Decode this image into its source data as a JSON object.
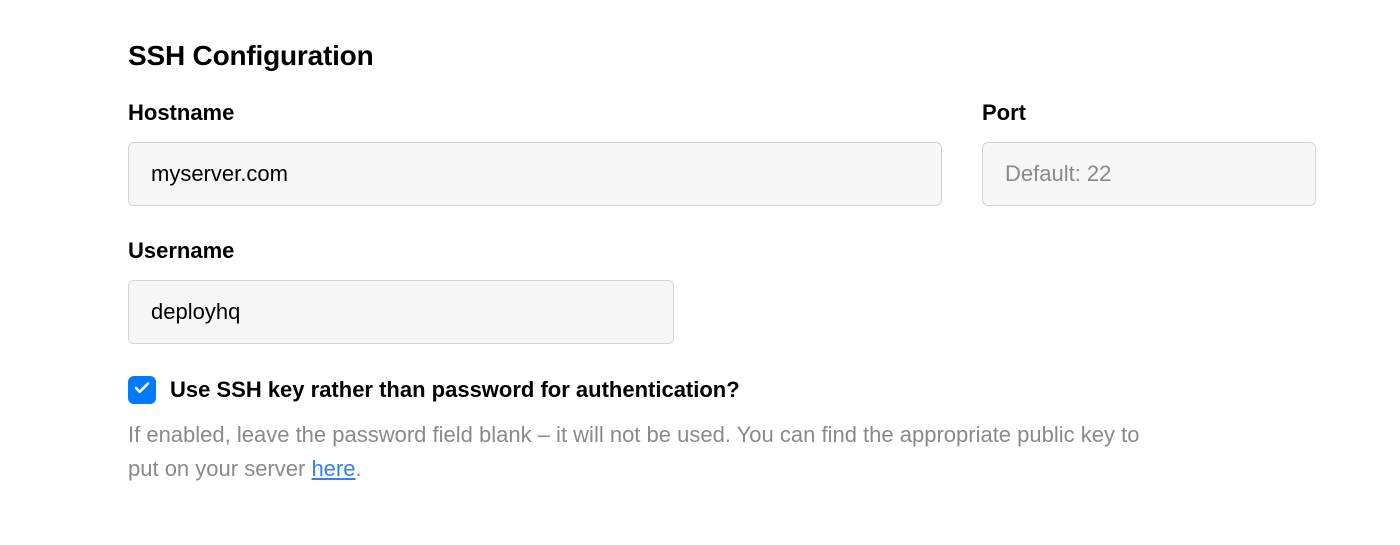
{
  "section": {
    "title": "SSH Configuration"
  },
  "fields": {
    "hostname": {
      "label": "Hostname",
      "value": "myserver.com",
      "placeholder": ""
    },
    "port": {
      "label": "Port",
      "value": "",
      "placeholder": "Default: 22"
    },
    "username": {
      "label": "Username",
      "value": "deployhq",
      "placeholder": ""
    }
  },
  "ssh_key_option": {
    "checked": true,
    "label": "Use SSH key rather than password for authentication?",
    "help_prefix": "If enabled, leave the password field blank – it will not be used. You can find the appropriate public key to put on your server ",
    "help_link_text": "here",
    "help_suffix": "."
  },
  "colors": {
    "accent": "#007aff",
    "link": "#2f81f7",
    "input_bg": "#f7f7f7",
    "input_border": "#d4d4d4",
    "muted_text": "#8a8a8a"
  }
}
